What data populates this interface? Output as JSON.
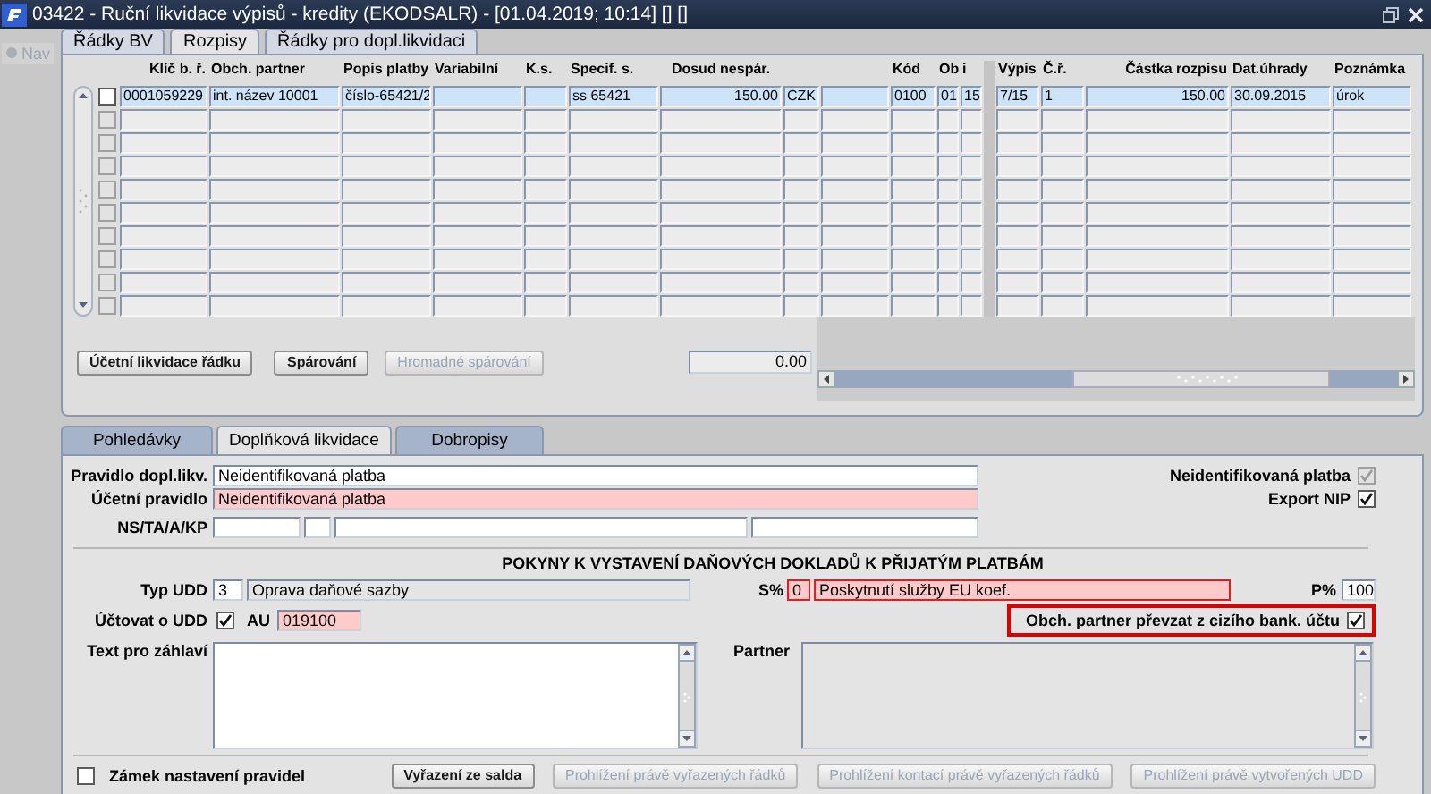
{
  "window": {
    "title": "03422 - Ruční likvidace výpisů - kredity (EKODSALR) - [01.04.2019; 10:14] [] []"
  },
  "nav": {
    "label": "Nav",
    "disabled": true
  },
  "top_tabs": [
    {
      "label": "Řádky BV",
      "selected": false
    },
    {
      "label": "Rozpisy",
      "selected": true
    },
    {
      "label": "Řádky pro dopl.likvidaci",
      "selected": false
    }
  ],
  "table": {
    "columns": [
      {
        "label": "Klíč b. ř."
      },
      {
        "label": "Obch. partner"
      },
      {
        "label": "Popis platby"
      },
      {
        "label": "Variabilní"
      },
      {
        "label": "K.s."
      },
      {
        "label": "Specif. s."
      },
      {
        "label": "Dosud nespár."
      },
      {},
      {},
      {
        "label": "Kód"
      },
      {
        "label": "Ob"
      },
      {
        "label": "i"
      },
      {
        "label": "Výpis"
      },
      {
        "label": "Č.ř."
      },
      {
        "label": "Částka rozpisu"
      },
      {
        "label": "Dat.úhrady"
      },
      {
        "label": "Poznámka"
      }
    ],
    "rows": [
      {
        "selected": true,
        "checked": false,
        "disabled": false,
        "cells": [
          "0001059229",
          "int. název 10001",
          "číslo-65421/2",
          null,
          null,
          "ss 65421",
          "150.00",
          "CZK",
          null,
          "0100",
          "01",
          "15",
          "7/15",
          "1",
          "150.00",
          "30.09.2015",
          "úrok"
        ]
      },
      {
        "selected": false,
        "checked": false,
        "disabled": true
      },
      {
        "selected": false,
        "checked": false,
        "disabled": true
      },
      {
        "selected": false,
        "checked": false,
        "disabled": true
      },
      {
        "selected": false,
        "checked": false,
        "disabled": true
      },
      {
        "selected": false,
        "checked": false,
        "disabled": true
      },
      {
        "selected": false,
        "checked": false,
        "disabled": true
      },
      {
        "selected": false,
        "checked": false,
        "disabled": true
      },
      {
        "selected": false,
        "checked": false,
        "disabled": true
      },
      {
        "selected": false,
        "checked": false,
        "disabled": true
      }
    ]
  },
  "buttons": [
    {
      "label": "Účetní likvidace řádku",
      "disabled": false
    },
    {
      "label": "Spárování",
      "disabled": false
    },
    {
      "label": "Hromadné spárování",
      "disabled": true
    }
  ],
  "total": "0.00",
  "bottom_tabs": [
    {
      "label": "Pohledávky",
      "selected": false
    },
    {
      "label": "Doplňková likvidace",
      "selected": true
    },
    {
      "label": "Dobropisy",
      "selected": false
    }
  ],
  "form": {
    "pravidlo": {
      "label": "Pravidlo dopl.likv.",
      "value": "Neidentifikovaná platba",
      "kind": "normal"
    },
    "ucetni_pravidlo": {
      "label": "Účetní pravidlo",
      "value": "Neidentifikovaná platba",
      "kind": "required"
    },
    "ns_ta_a_kp": {
      "label": "NS/TA/A/KP",
      "fields": [
        {
          "kind": "normal"
        },
        {
          "kind": "normal"
        },
        {
          "kind": "normal"
        },
        {
          "kind": "normal"
        }
      ]
    },
    "neidentifikovana": {
      "label": "Neidentifikovaná platba",
      "checked": true,
      "disabled": true
    },
    "export_nip": {
      "label": "Export NIP",
      "checked": true,
      "disabled": false
    },
    "section_title": "POKYNY K VYSTAVENÍ DAŇOVÝCH DOKLADŮ K PŘIJATÝM PLATBÁM",
    "typ_udd": {
      "label": "Typ UDD",
      "code": {
        "value": "3",
        "kind": "normal"
      },
      "name": {
        "value": "Oprava daňové sazby",
        "kind": "readonly"
      }
    },
    "s_pct": {
      "label": "S%",
      "code": {
        "value": "0",
        "kind": "required",
        "error": true
      },
      "name": {
        "value": "Poskytnutí služby EU koef.",
        "kind": "required",
        "error": true
      }
    },
    "p_pct": {
      "label": "P%",
      "value": "100",
      "kind": "normal"
    },
    "uctovat_o_udd": {
      "label": "Účtovat o UDD",
      "checked": true
    },
    "au": {
      "label": "AU",
      "value": "019100",
      "kind": "required"
    },
    "obch_partner": {
      "label": "Obch. partner převzat z cizího bank. účtu",
      "checked": true,
      "highlighted": true
    },
    "text_zahlavi": {
      "label": "Text pro záhlaví",
      "kind": "normal"
    },
    "partner": {
      "label": "Partner",
      "kind": "readonly"
    },
    "zamek": {
      "label": "Zámek nastavení pravidel",
      "checked": false
    },
    "actions": [
      {
        "label": "Vyřazení ze salda",
        "disabled": false
      },
      {
        "label": "Prohlížení právě vyřazených řádků",
        "disabled": true
      },
      {
        "label": "Prohlížení kontací právě vyřazených řádků",
        "disabled": true
      },
      {
        "label": "Prohlížení právě vytvořených UDD",
        "disabled": true
      }
    ]
  }
}
